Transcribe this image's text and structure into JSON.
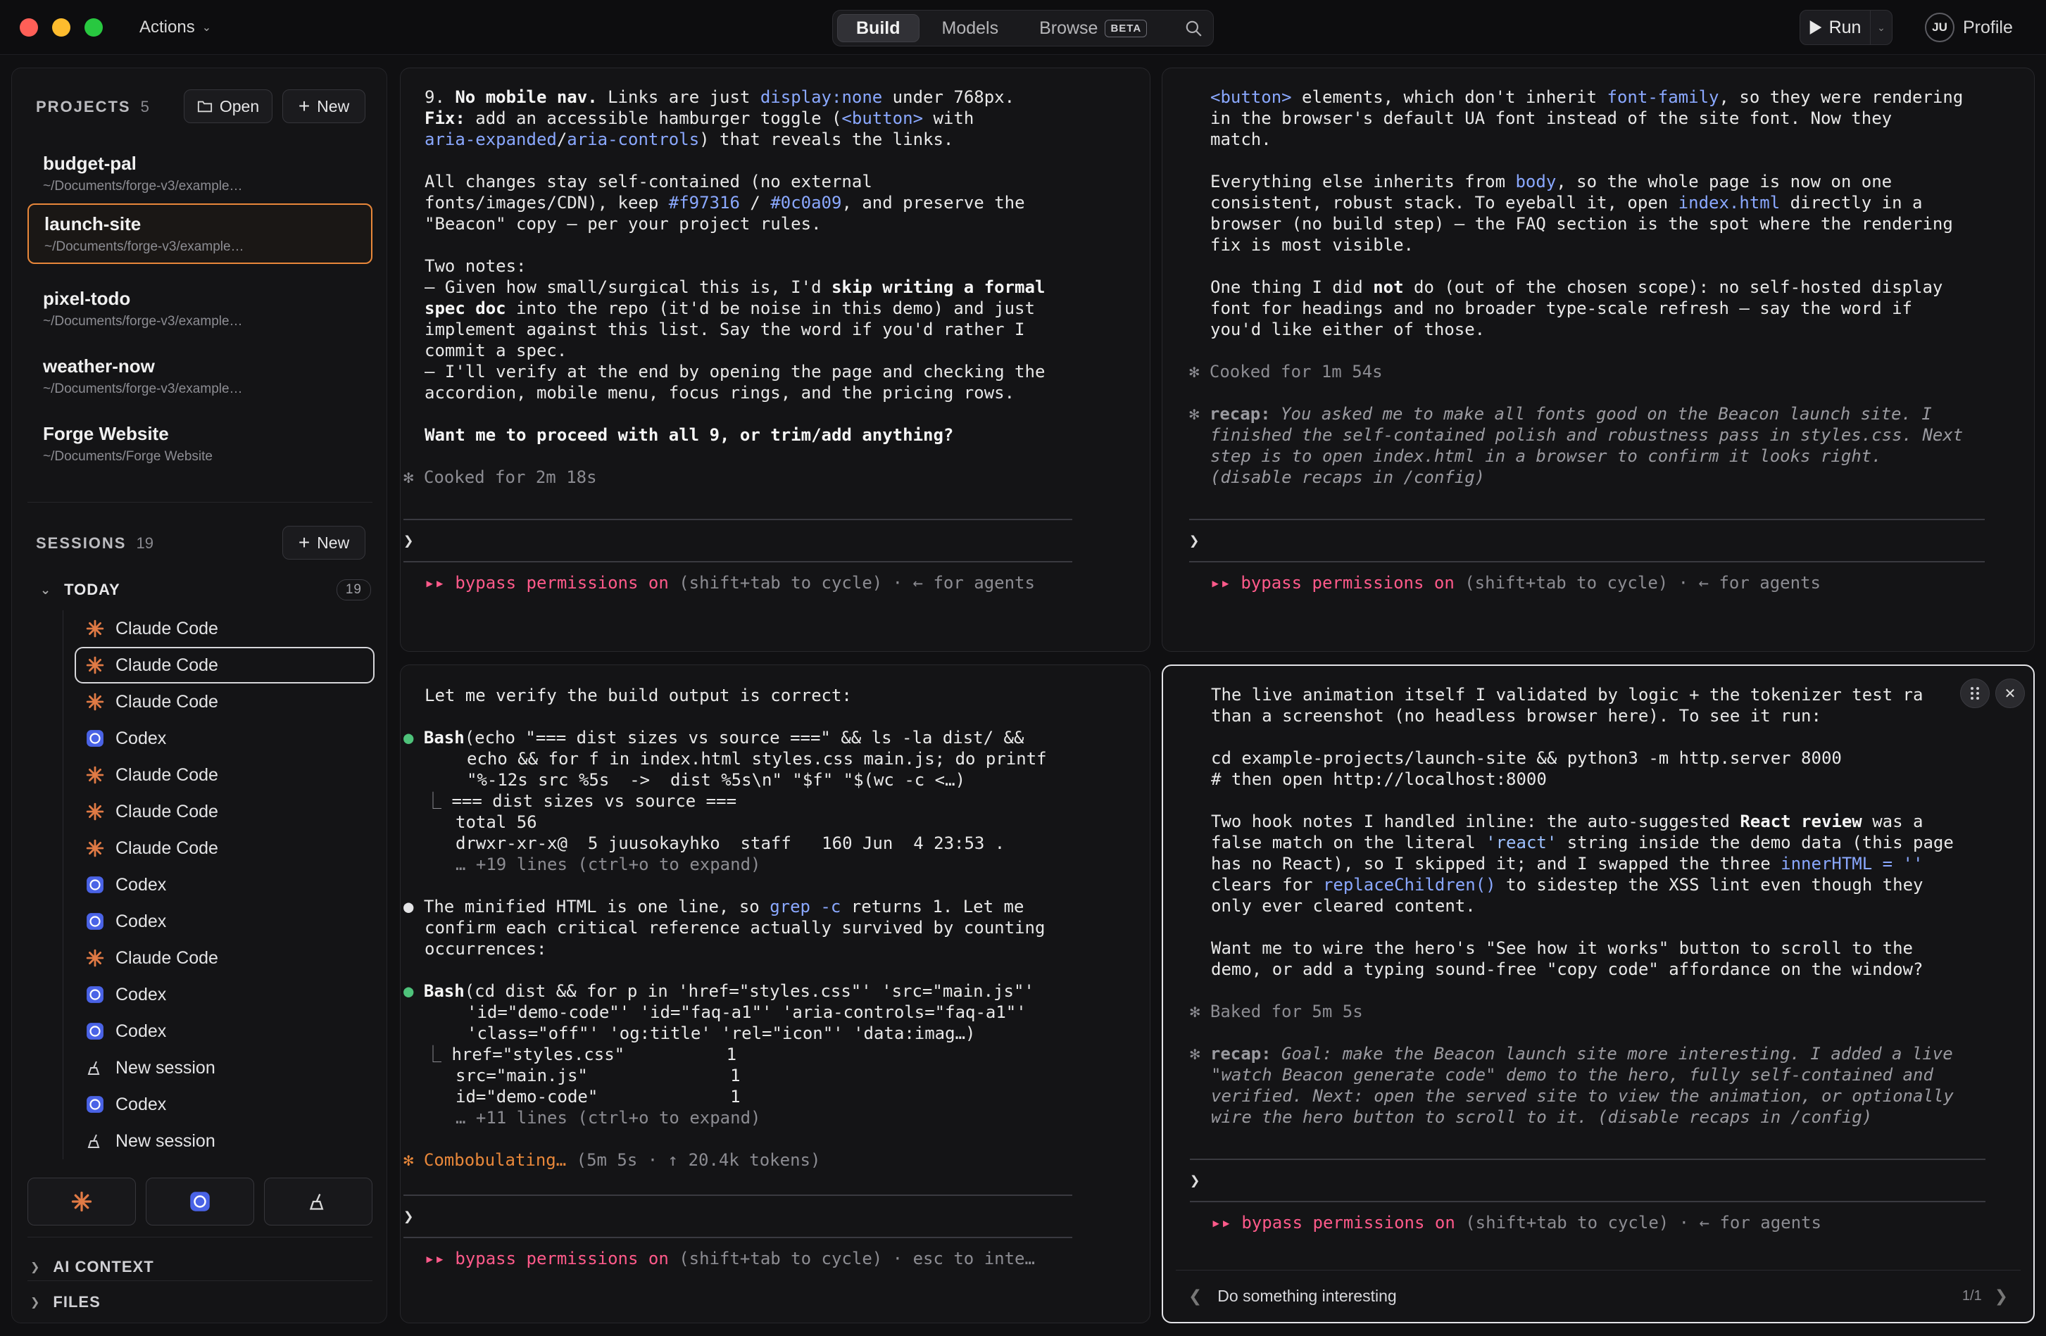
{
  "titlebar": {
    "actions_label": "Actions",
    "tabs": [
      {
        "label": "Build",
        "active": true
      },
      {
        "label": "Models",
        "active": false
      },
      {
        "label": "Browse",
        "active": false,
        "badge": "BETA"
      }
    ],
    "run_label": "Run",
    "profile_initials": "JU",
    "profile_label": "Profile"
  },
  "sidebar": {
    "projects_heading": "PROJECTS",
    "projects_count": "5",
    "open_label": "Open",
    "new_label": "New",
    "projects": [
      {
        "name": "budget-pal",
        "path": "~/Documents/forge-v3/example…"
      },
      {
        "name": "launch-site",
        "path": "~/Documents/forge-v3/example…",
        "selected": true
      },
      {
        "name": "pixel-todo",
        "path": "~/Documents/forge-v3/example…"
      },
      {
        "name": "weather-now",
        "path": "~/Documents/forge-v3/example…"
      },
      {
        "name": "Forge Website",
        "path": "~/Documents/Forge Website"
      }
    ],
    "sessions_heading": "SESSIONS",
    "sessions_count": "19",
    "sessions_new_label": "New",
    "today_label": "TODAY",
    "today_count": "19",
    "sessions": [
      {
        "label": "Claude Code",
        "icon": "claude"
      },
      {
        "label": "Claude Code",
        "icon": "claude",
        "selected": true
      },
      {
        "label": "Claude Code",
        "icon": "claude"
      },
      {
        "label": "Codex",
        "icon": "codex"
      },
      {
        "label": "Claude Code",
        "icon": "claude"
      },
      {
        "label": "Claude Code",
        "icon": "claude"
      },
      {
        "label": "Claude Code",
        "icon": "claude"
      },
      {
        "label": "Codex",
        "icon": "codex"
      },
      {
        "label": "Codex",
        "icon": "codex"
      },
      {
        "label": "Claude Code",
        "icon": "claude"
      },
      {
        "label": "Codex",
        "icon": "codex"
      },
      {
        "label": "Codex",
        "icon": "codex"
      },
      {
        "label": "New session",
        "icon": "broom"
      },
      {
        "label": "Codex",
        "icon": "codex"
      },
      {
        "label": "New session",
        "icon": "broom"
      }
    ],
    "ai_context_label": "AI CONTEXT",
    "files_label": "FILES"
  },
  "panes": {
    "tl": {
      "l1_num": "9. ",
      "l1_b": "No mobile nav.",
      "l1_t": " Links are just ",
      "l1_c": "display:none",
      "l1_e": " under 768px.",
      "l2_b": "Fix:",
      "l2_t": " add an accessible hamburger toggle (",
      "l2_c": "<button>",
      "l2_e": " with",
      "l3_c1": "aria-expanded",
      "l3_s": "/",
      "l3_c2": "aria-controls",
      "l3_e": ") that reveals the links.",
      "l4": "All changes stay self-contained (no external",
      "l5_t": "fonts/images/CDN), keep ",
      "l5_c1": "#f97316",
      "l5_s": " / ",
      "l5_c2": "#0c0a09",
      "l5_e": ", and preserve the",
      "l6": "\"Beacon\" copy — per your project rules.",
      "l7": "Two notes:",
      "l8_t": "– Given how small/surgical this is, I'd ",
      "l8_b": "skip writing a formal",
      "l9_b": "spec doc",
      "l9_e": " into the repo (it'd be noise in this demo) and just",
      "l10": "implement against this list. Say the word if you'd rather I",
      "l11": "commit a spec.",
      "l12": "– I'll verify at the end by opening the page and checking the",
      "l13": "accordion, mobile menu, focus rings, and the pricing rows.",
      "l14": "Want me to proceed with all 9, or trim/add anything?",
      "status": "✻ Cooked for 2m 18s",
      "prompt": "❯",
      "perm_a": "▸▸ bypass permissions on",
      "perm_b": " (shift+tab to cycle) · ← for agents"
    },
    "tr": {
      "l1_c1": "<button>",
      "l1_t": " elements, which don't inherit ",
      "l1_c2": "font-family",
      "l1_e": ", so they were rendering",
      "l2": "in the browser's default UA font instead of the site font. Now they",
      "l3": "match.",
      "l4_t": "Everything else inherits from ",
      "l4_c": "body",
      "l4_e": ", so the whole page is now on one",
      "l5_t": "consistent, robust stack. To eyeball it, open ",
      "l5_c": "index.html",
      "l5_e": " directly in a",
      "l6": "browser (no build step) — the FAQ section is the spot where the rendering",
      "l7": "fix is most visible.",
      "l8_t": "One thing I did ",
      "l8_b": "not",
      "l8_e": " do (out of the chosen scope): no self-hosted display",
      "l9": "font for headings and no broader type-scale refresh — say the word if",
      "l10": "you'd like either of those.",
      "status": "✻ Cooked for 1m 54s",
      "recap_label": "recap:",
      "recap1": " You asked me to make all fonts good on the Beacon launch site. I",
      "recap2": "finished the self-contained polish and robustness pass in styles.css. Next",
      "recap3": "step is to open index.html in a browser to confirm it looks right.",
      "recap4": "(disable recaps in /config)",
      "prompt": "❯",
      "perm_a": "▸▸ bypass permissions on",
      "perm_b": " (shift+tab to cycle) · ← for agents"
    },
    "bl": {
      "l1": "Let me verify the build output is correct:",
      "bash1_b": "Bash",
      "bash1_t": "(echo \"=== dist sizes vs source ===\" && ls -la dist/ &&",
      "bash1_2": "echo && for f in index.html styles.css main.js; do printf",
      "bash1_3": "\"%-12s src %5s  ->  dist %5s\\n\" \"$f\" \"$(wc -c <…)",
      "out1_1": "=== dist sizes vs source ===",
      "out1_2": "total 56",
      "out1_3": "drwxr-xr-x@  5 juusokayhko  staff   160 Jun  4 23:53 .",
      "out1_4": "… +19 lines (ctrl+o to expand)",
      "msg1_t": "The minified HTML is one line, so ",
      "msg1_c": "grep -c",
      "msg1_e": " returns 1. Let me",
      "msg2": "confirm each critical reference actually survived by counting",
      "msg3": "occurrences:",
      "bash2_b": "Bash",
      "bash2_t": "(cd dist && for p in 'href=\"styles.css\"' 'src=\"main.js\"'",
      "bash2_2": "'id=\"demo-code\"' 'id=\"faq-a1\"' 'aria-controls=\"faq-a1\"'",
      "bash2_3": "'class=\"off\"' 'og:title' 'rel=\"icon\"' 'data:imag…)",
      "out2_1": "href=\"styles.css\"          1",
      "out2_2": "src=\"main.js\"              1",
      "out2_3": "id=\"demo-code\"             1",
      "out2_4": "… +11 lines (ctrl+o to expand)",
      "status_a": "✻ Combobulating…",
      "status_b": " (5m 5s · ↑ 20.4k tokens)",
      "prompt": "❯",
      "perm_a": "▸▸ bypass permissions on",
      "perm_b": " (shift+tab to cycle) · esc to inte…"
    },
    "br": {
      "l1": "The live animation itself I validated by logic + the tokenizer test ra",
      "l2": "than a screenshot (no headless browser here). To see it run:",
      "l3": "cd example-projects/launch-site && python3 -m http.server 8000",
      "l4": "# then open http://localhost:8000",
      "l5_t": "Two hook notes I handled inline: the auto-suggested ",
      "l5_b": "React review",
      "l5_e": " was a",
      "l6_t": "false match on the literal ",
      "l6_s": "'react'",
      "l6_e": " string inside the demo data (this page",
      "l7_t": "has no React), so I skipped it; and I swapped the three ",
      "l7_c": "innerHTML = ''",
      "l8_t": "clears for ",
      "l8_c": "replaceChildren()",
      "l8_e": " to sidestep the XSS lint even though they",
      "l9": "only ever cleared content.",
      "l10": "Want me to wire the hero's \"See how it works\" button to scroll to the",
      "l11": "demo, or add a typing sound-free \"copy code\" affordance on the window?",
      "status": "✻ Baked for 5m 5s",
      "recap_label": "recap:",
      "recap1": " Goal: make the Beacon launch site more interesting. I added a live",
      "recap2": "\"watch Beacon generate code\" demo to the hero, fully self-contained and",
      "recap3": "verified. Next: open the served site to view the animation, or optionally",
      "recap4": "wire the hero button to scroll to it. (disable recaps in /config)",
      "prompt": "❯",
      "perm_a": "▸▸ bypass permissions on",
      "perm_b": " (shift+tab to cycle) · ← for agents",
      "tab_label": "Do something interesting",
      "tab_count": "1/1"
    }
  }
}
